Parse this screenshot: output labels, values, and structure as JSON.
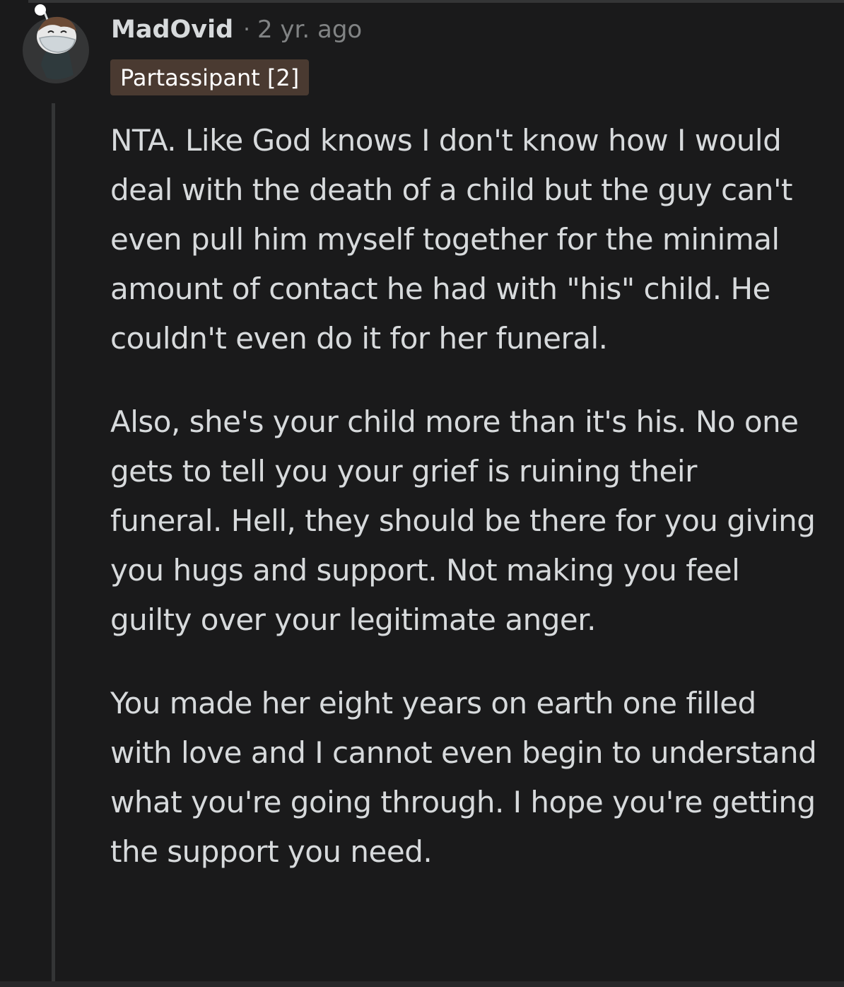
{
  "comment": {
    "author": "MadOvid",
    "separator": "·",
    "age": "2 yr. ago",
    "flair": "Partassipant [2]",
    "paragraphs": [
      "NTA. Like God knows I don't know how I would deal with the death of a child but the guy can't even pull him myself together for the minimal amount of contact he had with \"his\" child. He couldn't even do it for her funeral.",
      "Also, she's your child more than it's his. No one gets to tell you your grief is ruining their funeral. Hell, they should be there for you giving you hugs and support. Not making you feel guilty over your legitimate anger.",
      "You made her eight years on earth one filled with love and I cannot even begin to understand what you're going through. I hope you're getting the support you need."
    ]
  },
  "colors": {
    "background": "#1a1a1b",
    "text": "#d7dadc",
    "meta": "#818384",
    "flair_background": "#4a3a31",
    "thread_line": "#343536"
  },
  "icons": {
    "avatar": "snoo-avatar-icon"
  }
}
